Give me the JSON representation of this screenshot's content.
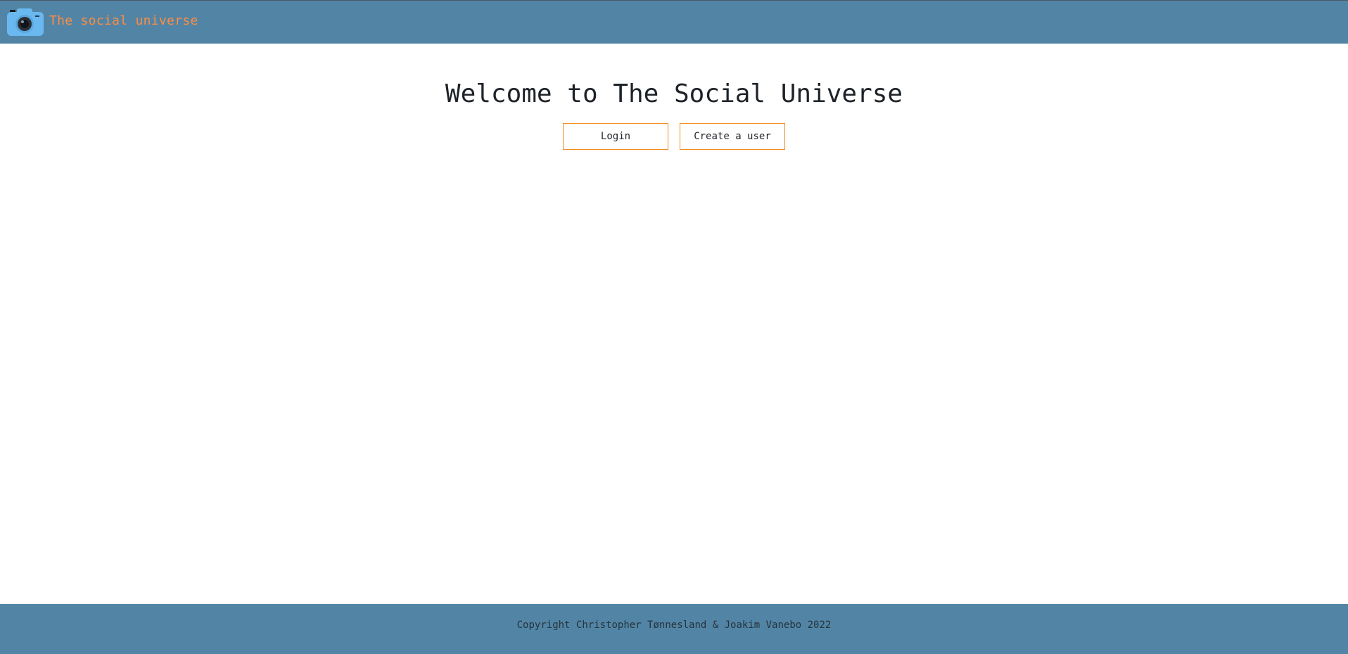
{
  "header": {
    "logo_icon": "camera-icon",
    "site_title": "The social universe",
    "colors": {
      "background": "#5285a5",
      "title": "#ff8c42",
      "icon": "#6ab8f0"
    }
  },
  "main": {
    "heading": "Welcome to The Social Universe",
    "buttons": {
      "login_label": "Login",
      "create_user_label": "Create a user",
      "border_color": "#f28a1e"
    }
  },
  "footer": {
    "copyright": "Copyright Christopher Tønnesland & Joakim Vanebo 2022",
    "background": "#5285a5"
  }
}
